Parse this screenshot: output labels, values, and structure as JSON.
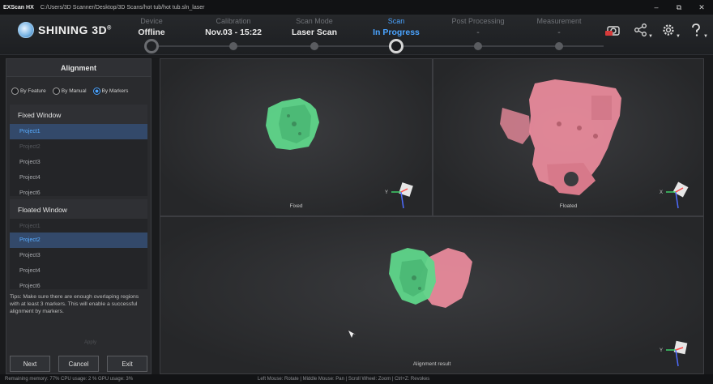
{
  "titlebar": {
    "app": "EXScan HX",
    "path": "C:/Users/3D Scanner/Desktop/3D Scans/hot tub/hot tub.sln_laser"
  },
  "logo": {
    "text": "SHINING 3D",
    "reg": "®"
  },
  "steps": [
    {
      "key": "Device",
      "value": "Offline"
    },
    {
      "key": "Calibration",
      "value": "Nov.03 - 15:22"
    },
    {
      "key": "Scan Mode",
      "value": "Laser Scan"
    },
    {
      "key": "Scan",
      "value": "In Progress"
    },
    {
      "key": "Post Processing",
      "value": "-"
    },
    {
      "key": "Measurement",
      "value": "-"
    }
  ],
  "tools": {
    "record_icon": "camera-rec-icon",
    "share_icon": "share-icon",
    "settings_icon": "gear-icon",
    "help_icon": "help-icon"
  },
  "panel": {
    "title": "Alignment",
    "radios": [
      {
        "label": "By Feature",
        "selected": false
      },
      {
        "label": "By Manual",
        "selected": false
      },
      {
        "label": "By Markers",
        "selected": true
      }
    ],
    "fixed": {
      "title": "Fixed Window",
      "items": [
        "Project1",
        "Project2",
        "Project3",
        "Project4",
        "Project6"
      ]
    },
    "floated": {
      "title": "Floated Window",
      "items": [
        "Project1",
        "Project2",
        "Project3",
        "Project4",
        "Project6"
      ]
    },
    "tips": "Tips: Make sure there are enough overlaping regions with at least 3 markers. This will enable a successful alignment by markers.",
    "ghost": "Apply",
    "buttons": {
      "next": "Next",
      "cancel": "Cancel",
      "exit": "Exit"
    }
  },
  "viewports": {
    "fixed": "Fixed",
    "floated": "Floated",
    "result": "Alignment result"
  },
  "axis": {
    "y": "Y",
    "x": "X"
  },
  "status": {
    "left": "Remaining memory: 77%  CPU usage: 2 %  GPU usage: 3%",
    "center": "Left Mouse: Rotate | Middle Mouse: Pan | Scroll Wheel: Zoom | Ctrl+Z: Revokes"
  },
  "colors": {
    "accent": "#4aa3ff",
    "green_scan": "#5fd68a",
    "pink_scan": "#e88a9b"
  }
}
